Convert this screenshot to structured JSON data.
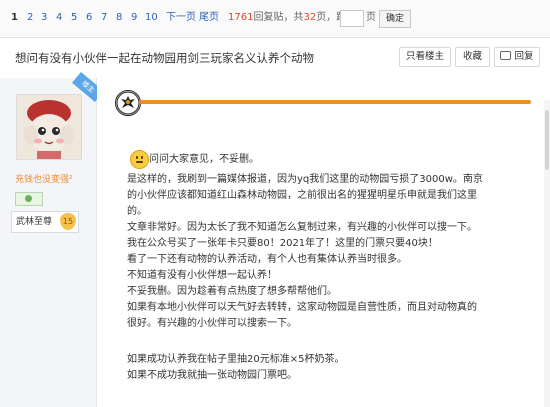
{
  "pager": {
    "pages": [
      "1",
      "2",
      "3",
      "4",
      "5",
      "6",
      "7",
      "8",
      "9",
      "10"
    ],
    "next_label": "下一页",
    "last_label": "尾页",
    "reply_count": "1761",
    "reply_suffix": "回复贴，共",
    "total_pages": "32",
    "pages_suffix": "页，跳到",
    "page_unit": "页",
    "confirm_label": "确定"
  },
  "thread": {
    "title": "想问有没有小伙伴一起在动物园用剑三玩家名义认养个动物",
    "only_op_label": "只看楼主",
    "favorite_label": "收藏",
    "reply_label": "回复"
  },
  "author": {
    "op_tag": "楼主",
    "title": "充钱也没变强²",
    "level_name": "武林至尊",
    "level_number": "15"
  },
  "post": {
    "lines": [
      "问问大家意见，不妥删。",
      "是这样的，我刷到一篇媒体报道，因为yq我们这里的动物园亏损了3000w。南京",
      "的小伙伴应该都知道红山森林动物园，之前很出名的猩猩明星乐申就是我们这里",
      "的。",
      "文章非常好。因为太长了我不知道怎么复制过来，有兴趣的小伙伴可以搜一下。",
      "我在公众号买了一张年卡只要80！2021年了！这里的门票只要40块！",
      "看了一下还有动物的认养活动，有个人也有集体认养当时很多。",
      "不知道有没有小伙伴想一起认养！",
      "不妥我删。因为趁着有点热度了想多帮帮他们。",
      "如果有本地小伙伴可以天气好去转转，这家动物园是自营性质，而且对动物真的",
      "很好。有兴趣的小伙伴可以搜索一下。",
      "",
      "如果成功认养我在帖子里抽20元标准×5杯奶茶。",
      "如果不成功我就抽一张动物园门票吧。"
    ]
  },
  "colors": {
    "link": "#2d64b3",
    "accent_orange": "#f28a2a",
    "reply_count_red": "#e0462a",
    "op_tag_blue": "#5ba6e6",
    "user_title_orange": "#f08a2c"
  },
  "icons": {
    "emblem": "eagle-emblem-icon",
    "smiley": "smiley-icon",
    "reply": "reply-bubble-icon"
  }
}
